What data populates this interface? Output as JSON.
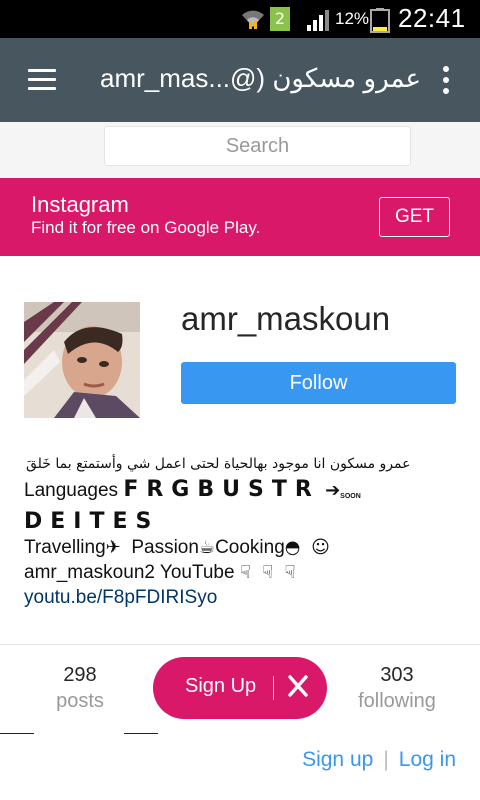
{
  "status_bar": {
    "notification_count": "2",
    "battery_percent": "12%",
    "time": "22:41"
  },
  "app_bar": {
    "title": "amr_mas...@) عمرو مسكون"
  },
  "search": {
    "placeholder": "Search"
  },
  "promo": {
    "title": "Instagram",
    "subtitle": "Find it for free on Google Play.",
    "button_label": "GET"
  },
  "profile": {
    "username": "amr_maskoun",
    "follow_label": "Follow",
    "bio": {
      "arabic_line": "عمرو مسكون انا موجود بهالحياة لحتى اعمل شي وأستمتع بما خَلقَ",
      "languages_prefix": "Languages",
      "languages_codes_1": "FRGBUSTR",
      "arrow_glyph": "➔",
      "soon_label": "SOON",
      "languages_codes_2": "DEITES",
      "travelling": "Travelling",
      "passion": "Passion",
      "cooking": "Cooking",
      "youtube_line": "amr_maskoun2 YouTube",
      "link": "youtu.be/F8pFDIRISyo"
    }
  },
  "stats": {
    "posts_count": "298",
    "posts_label": "posts",
    "following_count": "303",
    "following_label": "following"
  },
  "signup_bar": {
    "label": "Sign Up"
  },
  "bottom_links": {
    "sign_up": "Sign up",
    "separator": "|",
    "log_in": "Log in"
  },
  "colors": {
    "app_bar": "#47565f",
    "brand_pink": "#d91869",
    "follow_blue": "#3897f0",
    "link_blue": "#003569"
  }
}
